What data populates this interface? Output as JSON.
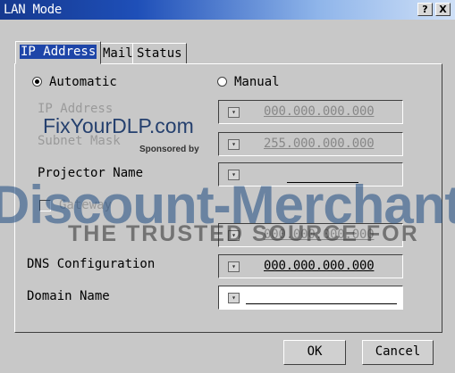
{
  "window": {
    "title": "LAN Mode",
    "help_button": "?",
    "close_button": "X"
  },
  "tabs": [
    {
      "label": "IP Address",
      "active": true
    },
    {
      "label": "Mail",
      "active": false
    },
    {
      "label": "Status",
      "active": false
    }
  ],
  "ip_mode": {
    "automatic": {
      "label": "Automatic",
      "selected": true
    },
    "manual": {
      "label": "Manual",
      "selected": false
    }
  },
  "fields": {
    "ip_address": {
      "label": "IP Address",
      "value": "000.000.000.000"
    },
    "subnet_mask": {
      "label": "Subnet Mask",
      "value": "255.000.000.000"
    },
    "projector_name": {
      "label": "Projector Name",
      "value": ""
    },
    "gateway": {
      "label": "Gateway",
      "value": "000.000.000.000",
      "checked": false
    },
    "dns": {
      "label": "DNS Configuration",
      "value": "000.000.000.000"
    },
    "domain_name": {
      "label": "Domain Name",
      "value": ""
    }
  },
  "buttons": {
    "ok": "OK",
    "cancel": "Cancel"
  },
  "watermark": {
    "site": "FixYourDLP.com",
    "sponsor": "Sponsored by",
    "brand": "Discount-Merchant",
    "tagline": "THE TRUSTED SOURCE FOR"
  },
  "colors": {
    "title_bar_start": "#16398f",
    "title_bar_end": "#cfe0f7",
    "active_tab": "#1e45a8",
    "dialog_face": "#c8c8c8"
  }
}
